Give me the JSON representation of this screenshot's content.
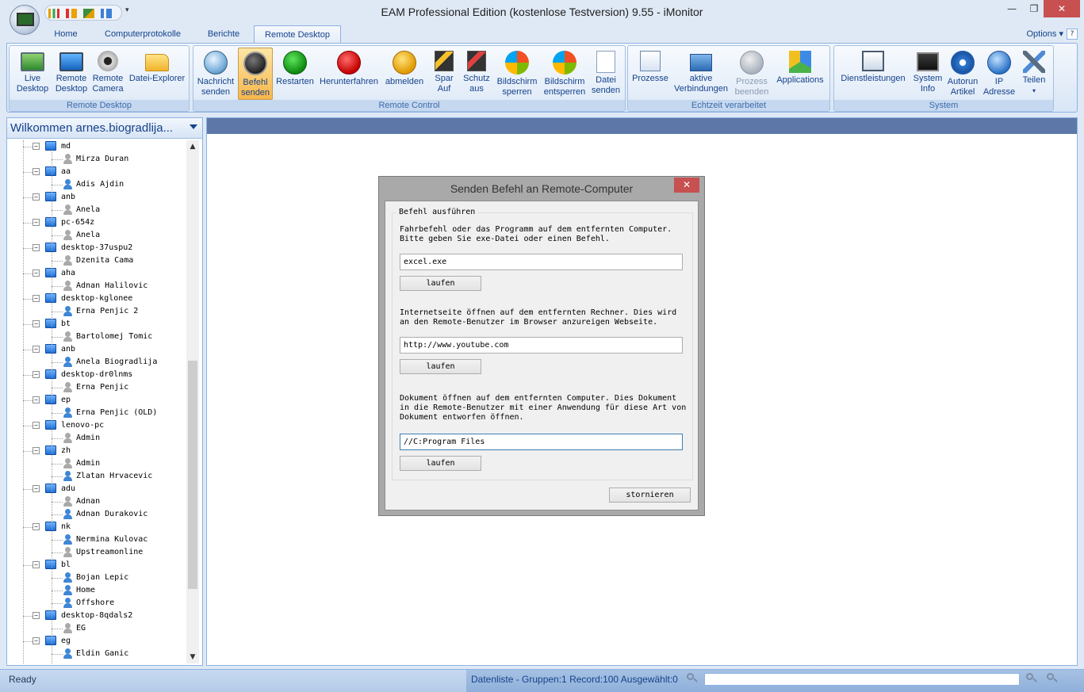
{
  "window": {
    "title": "EAM Professional Edition (kostenlose Testversion) 9.55 - iMonitor"
  },
  "tabs": [
    "Home",
    "Computerprotokolle",
    "Berichte",
    "Remote Desktop"
  ],
  "options_label": "Options",
  "ribbon": {
    "groups": [
      {
        "label": "Remote Desktop",
        "buttons": [
          {
            "l1": "Live",
            "l2": "Desktop",
            "icon": "monitor-icon"
          },
          {
            "l1": "Remote",
            "l2": "Desktop",
            "icon": "screen-icon"
          },
          {
            "l1": "Remote",
            "l2": "Camera",
            "icon": "webcam-icon"
          },
          {
            "l1": "Datei-Explorer",
            "l2": "",
            "icon": "folder-icon"
          }
        ]
      },
      {
        "label": "Remote Control",
        "buttons": [
          {
            "l1": "Nachricht",
            "l2": "senden",
            "icon": "message-icon"
          },
          {
            "l1": "Befehl",
            "l2": "senden",
            "icon": "command-icon"
          },
          {
            "l1": "Restarten",
            "l2": "",
            "icon": "restart-icon"
          },
          {
            "l1": "Herunterfahren",
            "l2": "",
            "icon": "power-icon"
          },
          {
            "l1": "abmelden",
            "l2": "",
            "icon": "logoff-key-icon"
          },
          {
            "l1": "Spar",
            "l2": "Auf",
            "icon": "screensaver-on-icon"
          },
          {
            "l1": "Schutz",
            "l2": "aus",
            "icon": "screensaver-off-icon"
          },
          {
            "l1": "Bildschirm",
            "l2": "sperren",
            "icon": "lock-screen-icon"
          },
          {
            "l1": "Bildschirm",
            "l2": "entsperren",
            "icon": "unlock-screen-icon"
          },
          {
            "l1": "Datei",
            "l2": "senden",
            "icon": "send-file-icon"
          }
        ]
      },
      {
        "label": "Echtzeit verarbeitet",
        "buttons": [
          {
            "l1": "Prozesse",
            "l2": "",
            "icon": "processes-icon"
          },
          {
            "l1": "aktive",
            "l2": "Verbindungen",
            "icon": "network-icon"
          },
          {
            "l1": "Prozess",
            "l2": "beenden",
            "icon": "kill-process-icon"
          },
          {
            "l1": "Applications",
            "l2": "",
            "icon": "applications-icon"
          }
        ]
      },
      {
        "label": "System",
        "buttons": [
          {
            "l1": "Dienstleistungen",
            "l2": "",
            "icon": "services-icon"
          },
          {
            "l1": "System",
            "l2": "Info",
            "icon": "system-info-icon"
          },
          {
            "l1": "Autorun",
            "l2": "Artikel",
            "icon": "autorun-gear-icon"
          },
          {
            "l1": "IP",
            "l2": "Adresse",
            "icon": "ip-address-icon"
          },
          {
            "l1": "Teilen",
            "l2": "",
            "icon": "share-tools-icon"
          }
        ]
      }
    ]
  },
  "left": {
    "header": "Wilkommen arnes.biogradlija...",
    "tree": [
      {
        "type": "pc",
        "label": "md"
      },
      {
        "type": "user",
        "label": "Mirza Duran",
        "color": "gray"
      },
      {
        "type": "pc",
        "label": "aa"
      },
      {
        "type": "user",
        "label": "Adis Ajdin",
        "color": "blue"
      },
      {
        "type": "pc",
        "label": "anb"
      },
      {
        "type": "user",
        "label": "Anela",
        "color": "gray"
      },
      {
        "type": "pc",
        "label": "pc-654z"
      },
      {
        "type": "user",
        "label": "Anela",
        "color": "gray"
      },
      {
        "type": "pc",
        "label": "desktop-37uspu2"
      },
      {
        "type": "user",
        "label": "Dzenita Cama",
        "color": "gray"
      },
      {
        "type": "pc",
        "label": "aha"
      },
      {
        "type": "user",
        "label": "Adnan Halilovic",
        "color": "gray"
      },
      {
        "type": "pc",
        "label": "desktop-kglonee"
      },
      {
        "type": "user",
        "label": "Erna Penjic 2",
        "color": "blue"
      },
      {
        "type": "pc",
        "label": "bt"
      },
      {
        "type": "user",
        "label": "Bartolomej Tomic",
        "color": "gray"
      },
      {
        "type": "pc",
        "label": "anb"
      },
      {
        "type": "user",
        "label": "Anela Biogradlija",
        "color": "blue"
      },
      {
        "type": "pc",
        "label": "desktop-dr0lnms"
      },
      {
        "type": "user",
        "label": "Erna Penjic",
        "color": "gray"
      },
      {
        "type": "pc",
        "label": "ep"
      },
      {
        "type": "user",
        "label": "Erna Penjic (OLD)",
        "color": "blue"
      },
      {
        "type": "pc",
        "label": "lenovo-pc"
      },
      {
        "type": "user",
        "label": "Admin",
        "color": "gray"
      },
      {
        "type": "pc",
        "label": "zh"
      },
      {
        "type": "user",
        "label": "Admin",
        "color": "gray"
      },
      {
        "type": "user",
        "label": "Zlatan Hrvacevic",
        "color": "blue"
      },
      {
        "type": "pc",
        "label": "adu"
      },
      {
        "type": "user",
        "label": "Adnan",
        "color": "gray"
      },
      {
        "type": "user",
        "label": "Adnan Durakovic",
        "color": "blue"
      },
      {
        "type": "pc",
        "label": "nk"
      },
      {
        "type": "user",
        "label": "Nermina Kulovac",
        "color": "blue"
      },
      {
        "type": "user",
        "label": "Upstreamonline",
        "color": "gray"
      },
      {
        "type": "pc",
        "label": "bl"
      },
      {
        "type": "user",
        "label": "Bojan Lepic",
        "color": "blue"
      },
      {
        "type": "user",
        "label": "Home",
        "color": "blue"
      },
      {
        "type": "user",
        "label": "Offshore",
        "color": "blue"
      },
      {
        "type": "pc",
        "label": "desktop-8qdals2"
      },
      {
        "type": "user",
        "label": "EG",
        "color": "gray"
      },
      {
        "type": "pc",
        "label": "eg"
      },
      {
        "type": "user",
        "label": "Eldin Ganic",
        "color": "blue"
      }
    ]
  },
  "dialog": {
    "title": "Senden Befehl an Remote-Computer",
    "close": "✕",
    "legend": "Befehl ausführen",
    "s1_text": "Fahrbefehl oder das Programm auf dem entfernten Computer.\nBitte geben Sie exe-Datei oder einen Befehl.",
    "s1_value": "excel.exe",
    "s2_text": "Internetseite öffnen auf dem entfernten Rechner. Dies wird\nan den Remote-Benutzer im Browser anzureigen Webseite.",
    "s2_value": "http://www.youtube.com",
    "s3_text": "Dokument öffnen auf dem entfernten Computer. Dies Dokument\nin die Remote-Benutzer mit einer Anwendung für diese Art von\nDokument entworfen öffnen.",
    "s3_value": "//C:Program Files",
    "run_label": "laufen",
    "cancel_label": "stornieren"
  },
  "status": {
    "ready": "Ready",
    "info": "Datenliste - Gruppen:1  Record:100  Ausgewählt:0"
  }
}
